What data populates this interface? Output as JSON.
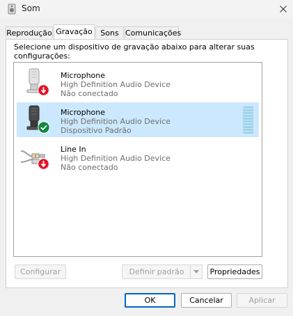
{
  "window": {
    "title": "Som"
  },
  "tabs": [
    {
      "label": "Reprodução",
      "active": false
    },
    {
      "label": "Gravação",
      "active": true
    },
    {
      "label": "Sons",
      "active": false
    },
    {
      "label": "Comunicações",
      "active": false
    }
  ],
  "instruction": "Selecione um dispositivo de gravação abaixo para alterar suas configurações:",
  "devices": [
    {
      "name": "Microphone",
      "driver": "High Definition Audio Device",
      "status": "Não conectado",
      "icon": "microphone-icon",
      "badge": "red-down-arrow-icon",
      "selected": false
    },
    {
      "name": "Microphone",
      "driver": "High Definition Audio Device",
      "status": "Dispositivo Padrão",
      "icon": "microphone-icon",
      "badge": "green-check-icon",
      "selected": true,
      "level_meter": 0
    },
    {
      "name": "Line In",
      "driver": "High Definition Audio Device",
      "status": "Não conectado",
      "icon": "line-in-cable-icon",
      "badge": "red-down-arrow-icon",
      "selected": false
    }
  ],
  "buttons": {
    "configure": "Configurar",
    "set_default": "Definir padrão",
    "properties": "Propriedades",
    "ok": "OK",
    "cancel": "Cancelar",
    "apply": "Aplicar"
  },
  "colors": {
    "selection": "#cce8ff",
    "accent": "#0067c0",
    "status_red": "#e81123",
    "status_green": "#10893e"
  }
}
